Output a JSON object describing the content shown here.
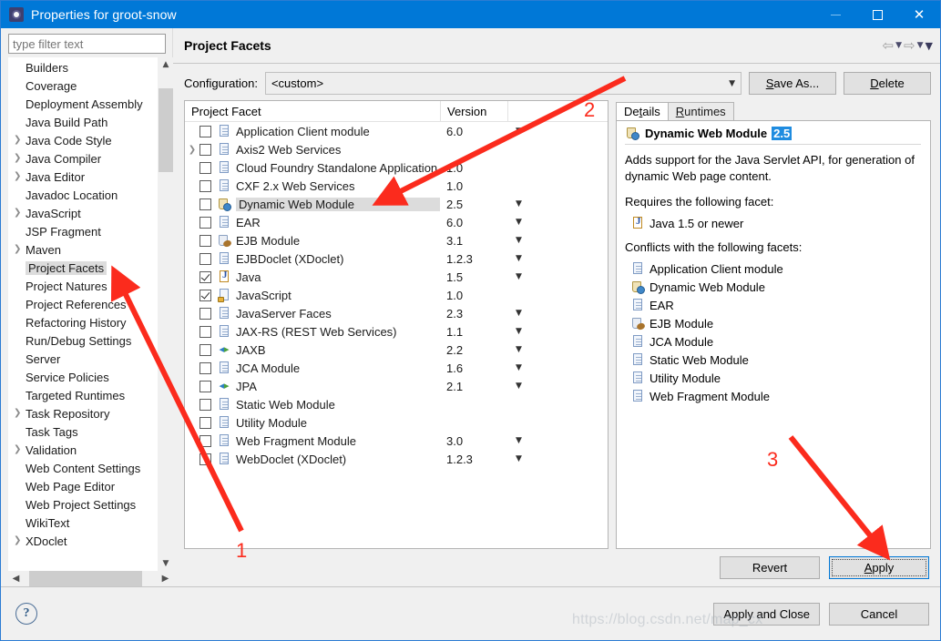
{
  "window": {
    "title": "Properties for groot-snow",
    "icon": "properties-gear-icon",
    "minimize_label": "—",
    "maximize_label": "□",
    "close_label": "✕"
  },
  "sidebar": {
    "filter_placeholder": "type filter text",
    "filter_value": "",
    "selected": "Project Facets",
    "items": [
      {
        "label": "Builders",
        "expandable": false
      },
      {
        "label": "Coverage",
        "expandable": false
      },
      {
        "label": "Deployment Assembly",
        "expandable": false
      },
      {
        "label": "Java Build Path",
        "expandable": false
      },
      {
        "label": "Java Code Style",
        "expandable": true
      },
      {
        "label": "Java Compiler",
        "expandable": true
      },
      {
        "label": "Java Editor",
        "expandable": true
      },
      {
        "label": "Javadoc Location",
        "expandable": false
      },
      {
        "label": "JavaScript",
        "expandable": true
      },
      {
        "label": "JSP Fragment",
        "expandable": false
      },
      {
        "label": "Maven",
        "expandable": true
      },
      {
        "label": "Project Facets",
        "expandable": false
      },
      {
        "label": "Project Natures",
        "expandable": false
      },
      {
        "label": "Project References",
        "expandable": false
      },
      {
        "label": "Refactoring History",
        "expandable": false
      },
      {
        "label": "Run/Debug Settings",
        "expandable": false
      },
      {
        "label": "Server",
        "expandable": false
      },
      {
        "label": "Service Policies",
        "expandable": false
      },
      {
        "label": "Targeted Runtimes",
        "expandable": false
      },
      {
        "label": "Task Repository",
        "expandable": true
      },
      {
        "label": "Task Tags",
        "expandable": false
      },
      {
        "label": "Validation",
        "expandable": true
      },
      {
        "label": "Web Content Settings",
        "expandable": false
      },
      {
        "label": "Web Page Editor",
        "expandable": false
      },
      {
        "label": "Web Project Settings",
        "expandable": false
      },
      {
        "label": "WikiText",
        "expandable": false
      },
      {
        "label": "XDoclet",
        "expandable": true
      }
    ],
    "scroll_up_icon": "chevron-up-icon",
    "scroll_down_icon": "chevron-down-icon",
    "scroll_left_icon": "chevron-left-icon",
    "scroll_right_icon": "chevron-right-icon"
  },
  "page": {
    "title": "Project Facets",
    "nav": {
      "back_icon": "arrow-left-icon",
      "back_menu_icon": "chevron-down-icon",
      "forward_icon": "arrow-right-icon",
      "forward_menu_icon": "chevron-down-icon",
      "more_icon": "chevron-down-icon"
    },
    "configuration_label": "Configuration:",
    "configuration_value": "<custom>",
    "configuration_caret": "chevron-down-icon",
    "save_as_label": "Save As...",
    "delete_label": "Delete"
  },
  "facets_table": {
    "columns": [
      "Project Facet",
      "Version"
    ],
    "rows": [
      {
        "name": "Application Client module",
        "version": "6.0",
        "checked": false,
        "expandable": false,
        "icon": "doc",
        "has_dropdown": true,
        "selected": false
      },
      {
        "name": "Axis2 Web Services",
        "version": "",
        "checked": false,
        "expandable": true,
        "icon": "doc",
        "has_dropdown": false,
        "selected": false
      },
      {
        "name": "Cloud Foundry Standalone Application",
        "version": "1.0",
        "checked": false,
        "expandable": false,
        "icon": "doc",
        "has_dropdown": false,
        "selected": false
      },
      {
        "name": "CXF 2.x Web Services",
        "version": "1.0",
        "checked": false,
        "expandable": false,
        "icon": "doc",
        "has_dropdown": false,
        "selected": false
      },
      {
        "name": "Dynamic Web Module",
        "version": "2.5",
        "checked": false,
        "expandable": false,
        "icon": "web",
        "has_dropdown": true,
        "selected": true
      },
      {
        "name": "EAR",
        "version": "6.0",
        "checked": false,
        "expandable": false,
        "icon": "doc",
        "has_dropdown": true,
        "selected": false
      },
      {
        "name": "EJB Module",
        "version": "3.1",
        "checked": false,
        "expandable": false,
        "icon": "ejb",
        "has_dropdown": true,
        "selected": false
      },
      {
        "name": "EJBDoclet (XDoclet)",
        "version": "1.2.3",
        "checked": false,
        "expandable": false,
        "icon": "doc",
        "has_dropdown": true,
        "selected": false
      },
      {
        "name": "Java",
        "version": "1.5",
        "checked": true,
        "expandable": false,
        "icon": "java",
        "has_dropdown": true,
        "selected": false
      },
      {
        "name": "JavaScript",
        "version": "1.0",
        "checked": true,
        "expandable": false,
        "icon": "js",
        "has_dropdown": false,
        "selected": false
      },
      {
        "name": "JavaServer Faces",
        "version": "2.3",
        "checked": false,
        "expandable": false,
        "icon": "doc",
        "has_dropdown": true,
        "selected": false
      },
      {
        "name": "JAX-RS (REST Web Services)",
        "version": "1.1",
        "checked": false,
        "expandable": false,
        "icon": "doc",
        "has_dropdown": true,
        "selected": false
      },
      {
        "name": "JAXB",
        "version": "2.2",
        "checked": false,
        "expandable": false,
        "icon": "xml",
        "has_dropdown": true,
        "selected": false
      },
      {
        "name": "JCA Module",
        "version": "1.6",
        "checked": false,
        "expandable": false,
        "icon": "doc",
        "has_dropdown": true,
        "selected": false
      },
      {
        "name": "JPA",
        "version": "2.1",
        "checked": false,
        "expandable": false,
        "icon": "xml",
        "has_dropdown": true,
        "selected": false
      },
      {
        "name": "Static Web Module",
        "version": "",
        "checked": false,
        "expandable": false,
        "icon": "doc",
        "has_dropdown": false,
        "selected": false
      },
      {
        "name": "Utility Module",
        "version": "",
        "checked": false,
        "expandable": false,
        "icon": "doc",
        "has_dropdown": false,
        "selected": false
      },
      {
        "name": "Web Fragment Module",
        "version": "3.0",
        "checked": false,
        "expandable": false,
        "icon": "doc",
        "has_dropdown": true,
        "selected": false
      },
      {
        "name": "WebDoclet (XDoclet)",
        "version": "1.2.3",
        "checked": false,
        "expandable": false,
        "icon": "doc",
        "has_dropdown": true,
        "selected": false
      }
    ]
  },
  "details": {
    "tabs": [
      {
        "label": "Details",
        "active": true
      },
      {
        "label": "Runtimes",
        "active": false
      }
    ],
    "facet_name": "Dynamic Web Module",
    "facet_version": "2.5",
    "description": "Adds support for the Java Servlet API, for generation of dynamic Web page content.",
    "requires_label": "Requires the following facet:",
    "requires": [
      {
        "label": "Java 1.5 or newer",
        "icon": "java"
      }
    ],
    "conflicts_label": "Conflicts with the following facets:",
    "conflicts": [
      {
        "label": "Application Client module",
        "icon": "doc"
      },
      {
        "label": "Dynamic Web Module",
        "icon": "web"
      },
      {
        "label": "EAR",
        "icon": "doc"
      },
      {
        "label": "EJB Module",
        "icon": "ejb"
      },
      {
        "label": "JCA Module",
        "icon": "doc"
      },
      {
        "label": "Static Web Module",
        "icon": "doc"
      },
      {
        "label": "Utility Module",
        "icon": "doc"
      },
      {
        "label": "Web Fragment Module",
        "icon": "doc"
      }
    ]
  },
  "buttons": {
    "revert": "Revert",
    "apply": "Apply",
    "apply_and_close": "Apply and Close",
    "cancel": "Cancel",
    "help_icon": "help-question-icon",
    "help_glyph": "?"
  },
  "annotations": {
    "numbers": [
      "1",
      "2",
      "3"
    ],
    "color": "#fb2b1d"
  },
  "watermark": "https://blog.csdn.net/map_cx",
  "colors": {
    "titlebar": "#0078d7",
    "accent": "#0078d7",
    "selection": "#dcdcdc",
    "badge": "#1f8ce0",
    "annotation": "#fb2b1d"
  }
}
